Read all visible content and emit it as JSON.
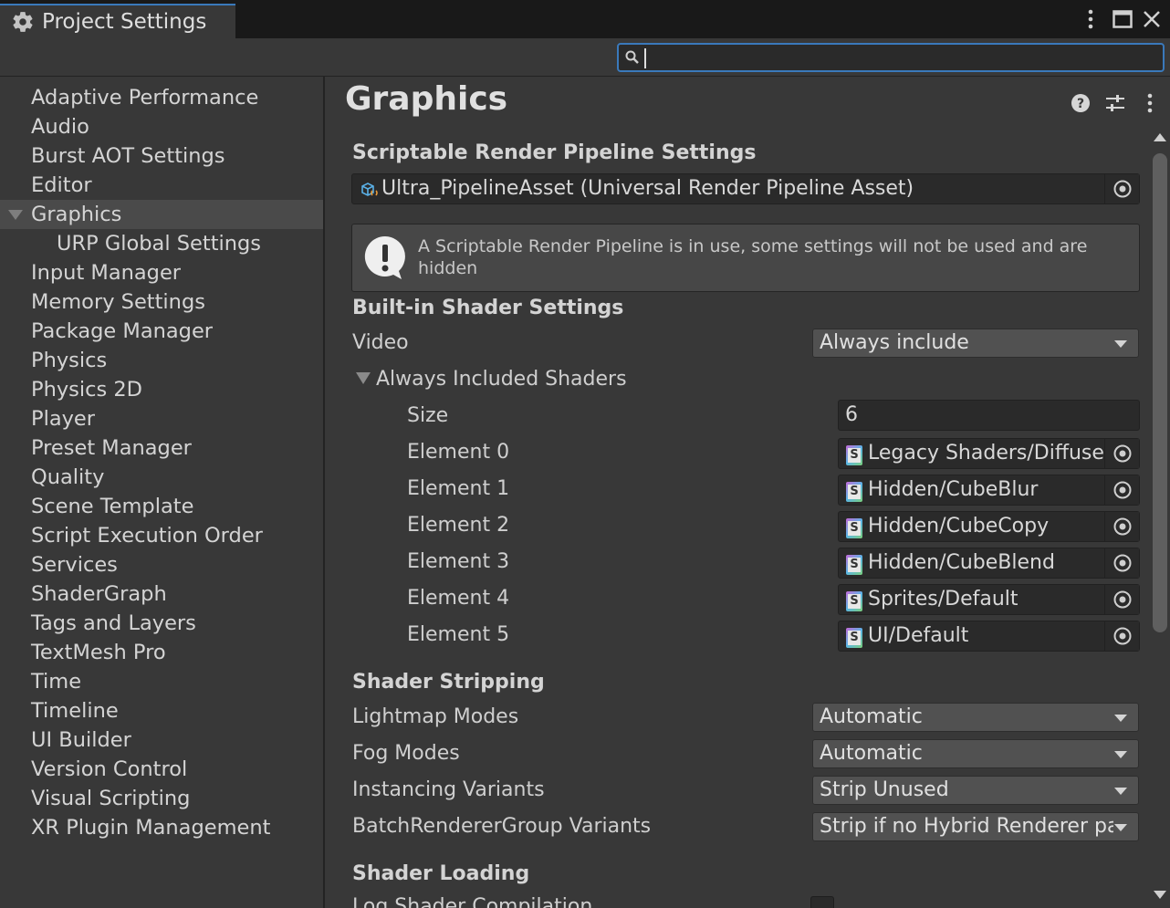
{
  "window": {
    "tab_title": "Project Settings"
  },
  "search": {
    "value": ""
  },
  "sidebar": {
    "items": [
      {
        "label": "Adaptive Performance"
      },
      {
        "label": "Audio"
      },
      {
        "label": "Burst AOT Settings"
      },
      {
        "label": "Editor"
      },
      {
        "label": "Graphics",
        "selected": true,
        "expanded": true
      },
      {
        "label": "URP Global Settings",
        "sub": true
      },
      {
        "label": "Input Manager"
      },
      {
        "label": "Memory Settings"
      },
      {
        "label": "Package Manager"
      },
      {
        "label": "Physics"
      },
      {
        "label": "Physics 2D"
      },
      {
        "label": "Player"
      },
      {
        "label": "Preset Manager"
      },
      {
        "label": "Quality"
      },
      {
        "label": "Scene Template"
      },
      {
        "label": "Script Execution Order"
      },
      {
        "label": "Services"
      },
      {
        "label": "ShaderGraph"
      },
      {
        "label": "Tags and Layers"
      },
      {
        "label": "TextMesh Pro"
      },
      {
        "label": "Time"
      },
      {
        "label": "Timeline"
      },
      {
        "label": "UI Builder"
      },
      {
        "label": "Version Control"
      },
      {
        "label": "Visual Scripting"
      },
      {
        "label": "XR Plugin Management"
      }
    ]
  },
  "main": {
    "title": "Graphics",
    "srp": {
      "section": "Scriptable Render Pipeline Settings",
      "asset": "Ultra_PipelineAsset (Universal Render Pipeline Asset)",
      "help": "A Scriptable Render Pipeline is in use, some settings will not be used and are hidden"
    },
    "builtin": {
      "section": "Built-in Shader Settings",
      "video_label": "Video",
      "video_value": "Always include",
      "shaders_label": "Always Included Shaders",
      "size_label": "Size",
      "size_value": "6",
      "elements": [
        {
          "label": "Element 0",
          "value": "Legacy Shaders/Diffuse"
        },
        {
          "label": "Element 1",
          "value": "Hidden/CubeBlur"
        },
        {
          "label": "Element 2",
          "value": "Hidden/CubeCopy"
        },
        {
          "label": "Element 3",
          "value": "Hidden/CubeBlend"
        },
        {
          "label": "Element 4",
          "value": "Sprites/Default"
        },
        {
          "label": "Element 5",
          "value": "UI/Default"
        }
      ]
    },
    "stripping": {
      "section": "Shader Stripping",
      "rows": [
        {
          "label": "Lightmap Modes",
          "value": "Automatic"
        },
        {
          "label": "Fog Modes",
          "value": "Automatic"
        },
        {
          "label": "Instancing Variants",
          "value": "Strip Unused"
        },
        {
          "label": "BatchRendererGroup Variants",
          "value": "Strip if no Hybrid Renderer package"
        }
      ]
    },
    "loading": {
      "section": "Shader Loading",
      "log_label": "Log Shader Compilation",
      "log_checked": false
    }
  },
  "icons": {
    "tab": "gear-icon",
    "header": [
      "help-icon",
      "preset-sliders-icon",
      "kebab-menu-icon"
    ],
    "window": [
      "kebab-menu-icon",
      "maximize-icon",
      "close-icon"
    ]
  },
  "colors": {
    "accent": "#3a79bb",
    "background": "#383838",
    "titlebar": "#191919"
  }
}
